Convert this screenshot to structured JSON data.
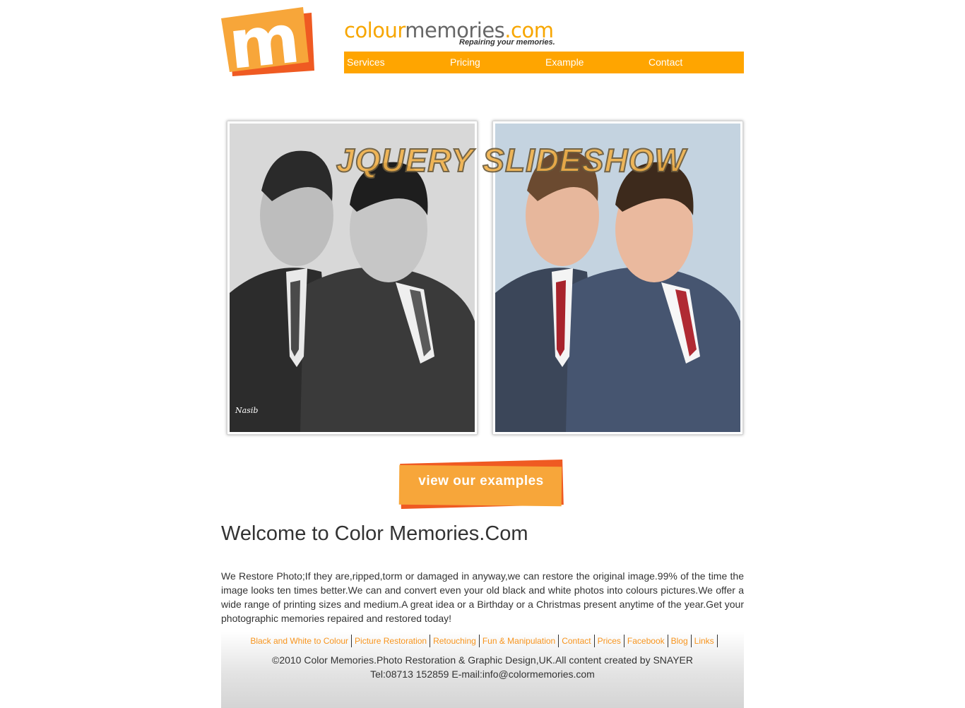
{
  "brand": {
    "name_part1": "colour",
    "name_part2": "memories",
    "name_part3": ".com",
    "tagline": "Repairing your memories.",
    "logo_letter": "m",
    "colors": {
      "orange": "#ffa500",
      "logo_red": "#ef5a22",
      "link_orange": "#f7941d"
    }
  },
  "nav": {
    "items": [
      {
        "label": "Services"
      },
      {
        "label": "Pricing"
      },
      {
        "label": "Example"
      },
      {
        "label": "Contact"
      }
    ]
  },
  "slideshow": {
    "label": "JQUERY SLIDESHOW",
    "photo_signature": "Nasib"
  },
  "examples_button": {
    "label": "view our examples"
  },
  "content": {
    "title": "Welcome to Color Memories.Com",
    "intro": "We Restore Photo;If they are,ripped,torm or damaged in anyway,we can restore the original image.99% of the time the image looks ten times better.We can and convert even your old black and white photos into colours pictures.We offer a wide range of printing sizes and medium.A great idea or a Birthday or a Christmas present anytime of the year.Get your photographic memories repaired and restored today!"
  },
  "footer": {
    "links": [
      {
        "label": "Black and White to Colour"
      },
      {
        "label": "Picture Restoration"
      },
      {
        "label": "Retouching"
      },
      {
        "label": "Fun & Manipulation"
      },
      {
        "label": "Contact"
      },
      {
        "label": "Prices"
      },
      {
        "label": "Facebook"
      },
      {
        "label": "Blog"
      },
      {
        "label": "Links"
      }
    ],
    "copyright": "©2010 Color Memories.Photo Restoration & Graphic Design,UK.All content created by SNAYER",
    "contact": "Tel:08713 152859 E-mail:info@colormemories.com"
  }
}
